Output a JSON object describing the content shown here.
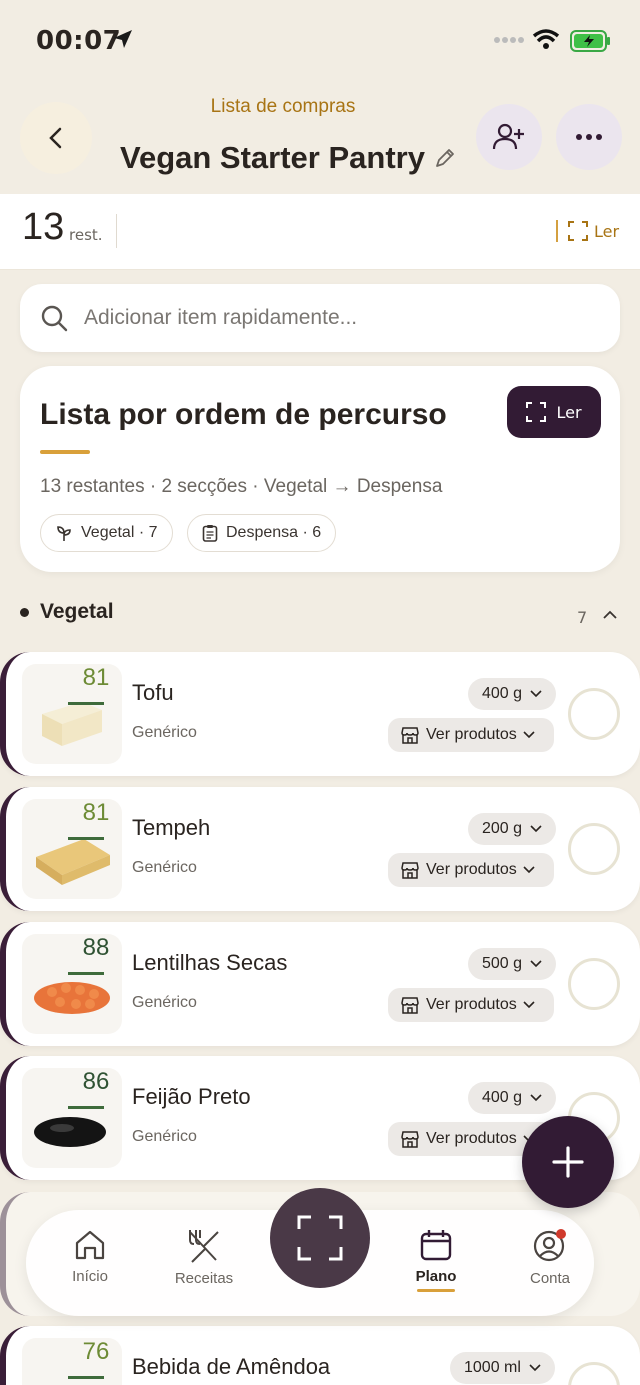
{
  "status": {
    "time": "00:07"
  },
  "header": {
    "subtitle": "Lista de compras",
    "title": "Vegan Starter Pantry"
  },
  "counter": {
    "number": "13",
    "unit": "rest.",
    "scan_label": "Ler"
  },
  "search": {
    "placeholder": "Adicionar item rapidamente..."
  },
  "route_card": {
    "title": "Lista por ordem de percurso",
    "read_label": "Ler",
    "summary": "13 restantes · 2 secções · Vegetal → Despensa",
    "chips": [
      {
        "label": "Vegetal · 7",
        "icon": "sprout-icon"
      },
      {
        "label": "Despensa · 6",
        "icon": "clipboard-icon"
      }
    ]
  },
  "section": {
    "name": "Vegetal",
    "count": "7"
  },
  "items": [
    {
      "score": "81",
      "name": "Tofu",
      "brand": "Genérico",
      "qty": "400 g",
      "products": "Ver produtos"
    },
    {
      "score": "81",
      "name": "Tempeh",
      "brand": "Genérico",
      "qty": "200 g",
      "products": "Ver produtos"
    },
    {
      "score": "88",
      "name": "Lentilhas Secas",
      "brand": "Genérico",
      "qty": "500 g",
      "products": "Ver produtos"
    },
    {
      "score": "86",
      "name": "Feijão Preto",
      "brand": "Genérico",
      "qty": "400 g",
      "products": "Ver produtos"
    },
    {
      "score": "76",
      "name": "Bebida de Amêndoa",
      "qty": "1000 ml"
    }
  ],
  "nav": {
    "tabs": [
      {
        "label": "Início"
      },
      {
        "label": "Receitas"
      },
      {
        "label": "Plano"
      },
      {
        "label": "Conta"
      }
    ]
  }
}
